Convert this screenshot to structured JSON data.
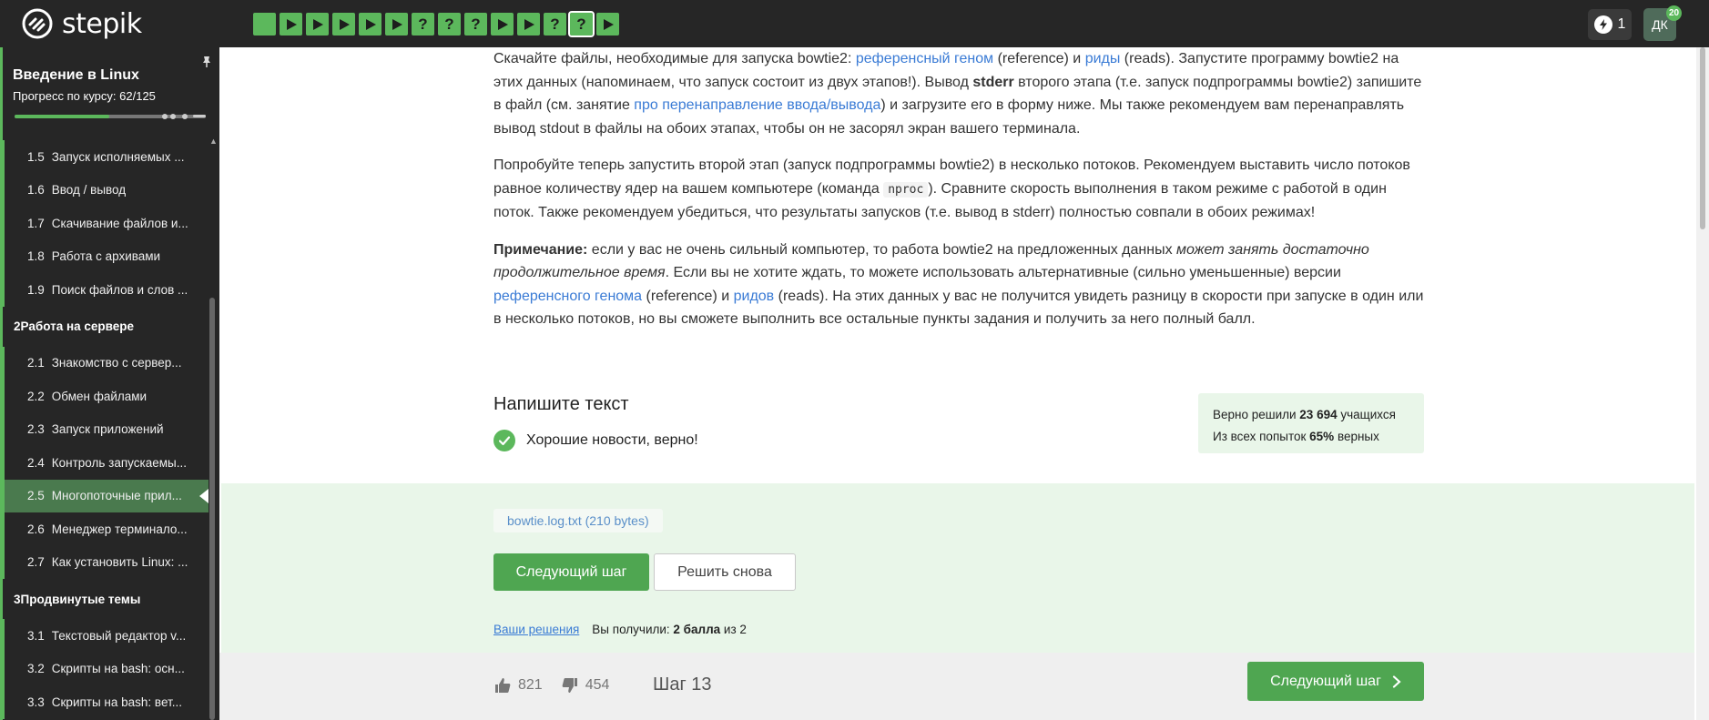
{
  "header": {
    "logo_text": "stepik",
    "steps": [
      {
        "type": "done"
      },
      {
        "type": "play"
      },
      {
        "type": "play"
      },
      {
        "type": "play"
      },
      {
        "type": "play"
      },
      {
        "type": "play"
      },
      {
        "type": "quiz"
      },
      {
        "type": "quiz"
      },
      {
        "type": "quiz"
      },
      {
        "type": "play"
      },
      {
        "type": "play"
      },
      {
        "type": "quiz"
      },
      {
        "type": "quiz",
        "current": true
      },
      {
        "type": "play"
      }
    ],
    "quiz_glyph": "?",
    "energy_count": "1",
    "avatar_initials": "ДК",
    "avatar_badge": "20"
  },
  "sidebar": {
    "course_title": "Введение в Linux",
    "progress_label": "Прогресс по курсу:  62/125",
    "progress_value": 0.496,
    "nav": [
      {
        "kind": "item",
        "num": "1.5",
        "label": "Запуск исполняемых ..."
      },
      {
        "kind": "item",
        "num": "1.6",
        "label": "Ввод / вывод"
      },
      {
        "kind": "item",
        "num": "1.7",
        "label": "Скачивание файлов и..."
      },
      {
        "kind": "item",
        "num": "1.8",
        "label": "Работа с архивами"
      },
      {
        "kind": "item",
        "num": "1.9",
        "label": "Поиск файлов и слов ..."
      },
      {
        "kind": "section",
        "num": "2",
        "label": "Работа на сервере"
      },
      {
        "kind": "item",
        "num": "2.1",
        "label": "Знакомство с сервер..."
      },
      {
        "kind": "item",
        "num": "2.2",
        "label": "Обмен файлами"
      },
      {
        "kind": "item",
        "num": "2.3",
        "label": "Запуск приложений"
      },
      {
        "kind": "item",
        "num": "2.4",
        "label": "Контроль запускаемы..."
      },
      {
        "kind": "item",
        "num": "2.5",
        "label": "Многопоточные прил...",
        "active": true
      },
      {
        "kind": "item",
        "num": "2.6",
        "label": "Менеджер терминало..."
      },
      {
        "kind": "item",
        "num": "2.7",
        "label": "Как установить Linux: ..."
      },
      {
        "kind": "section",
        "num": "3",
        "label": "Продвинутые темы"
      },
      {
        "kind": "item",
        "num": "3.1",
        "label": "Текстовый редактор v..."
      },
      {
        "kind": "item",
        "num": "3.2",
        "label": "Скрипты на bash: осн..."
      },
      {
        "kind": "item",
        "num": "3.3",
        "label": "Скрипты на bash: вет..."
      }
    ]
  },
  "lesson": {
    "p1_a": "Скачайте файлы, необходимые для запуска bowtie2: ",
    "p1_link1": "референсный геном",
    "p1_b": " (reference) и ",
    "p1_link2": "риды",
    "p1_c": " (reads). Запустите программу bowtie2 на этих данных (напоминаем, что запуск состоит из двух этапов!). Вывод ",
    "p1_bold": "stderr",
    "p1_d": " второго этапа (т.е. запуск подпрограммы bowtie2) запишите в файл (см. занятие ",
    "p1_link3": "про перенаправление ввода/вывода",
    "p1_e": ") и загрузите его в форму ниже. Мы также рекомендуем вам перенаправлять вывод stdout в файлы на обоих этапах, чтобы он не засорял экран вашего терминала.",
    "p2_a": "Попробуйте теперь запустить второй этап (запуск подпрограммы bowtie2) в несколько потоков. Рекомендуем выставить число потоков равное количеству ядер на вашем компьютере (команда ",
    "p2_code": "nproc",
    "p2_b": "). Сравните скорость выполнения в таком режиме с работой в один поток. Также рекомендуем убедиться, что результаты запусков (т.е. вывод в stderr) полностью совпали в обоих режимах!",
    "p3_bold": "Примечание:",
    "p3_a": " если у вас не очень сильный компьютер, то работа bowtie2 на предложенных данных ",
    "p3_italic": "может занять достаточно продолжительное время",
    "p3_b": ". Если вы не хотите ждать, то можете использовать альтернативные (сильно уменьшенные) версии ",
    "p3_link1": "референсного генома",
    "p3_c": " (reference) и ",
    "p3_link2": "ридов",
    "p3_d": " (reads). На этих данных у вас не получится увидеть разницу в скорости при запуске в один или в несколько потоков, но вы сможете выполнить все остальные пункты задания и получить за него полный балл."
  },
  "task": {
    "title": "Напишите текст",
    "verdict": "Хорошие новости, верно!",
    "stats_solved_prefix": "Верно решили ",
    "stats_solved_count": "23 694",
    "stats_solved_suffix": " учащихся",
    "stats_attempts_prefix": "Из всех попыток ",
    "stats_attempts_pct": "65%",
    "stats_attempts_suffix": " верных",
    "file_name": "bowtie.log.txt (210 bytes)",
    "next_button": "Следующий шаг",
    "retry_button": "Решить снова",
    "solutions_link": "Ваши решения",
    "score_prefix": "Вы получили: ",
    "score_value": "2 балла",
    "score_suffix": " из 2"
  },
  "footer": {
    "likes": "821",
    "dislikes": "454",
    "step_label": "Шаг 13",
    "next_button": "Следующий шаг"
  },
  "colors": {
    "accent": "#5cb85c",
    "dark": "#262626",
    "link": "#3a7bd5",
    "success_bg": "#e9f6e9"
  }
}
